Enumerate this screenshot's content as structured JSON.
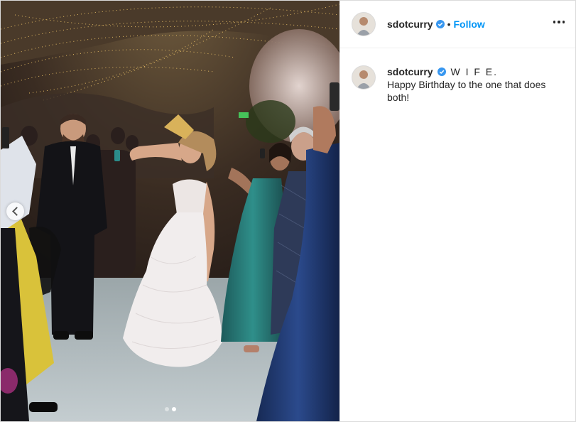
{
  "post": {
    "username": "sdotcurry",
    "verified": true,
    "bullet": "•",
    "follow_label": "Follow",
    "more_icon": "more-horizontal-icon"
  },
  "caption": {
    "username": "sdotcurry",
    "headline": "W I F E.",
    "body": "Happy Birthday to the one that does both!"
  },
  "carousel": {
    "total": 2,
    "current": 2,
    "prev_icon": "chevron-left-icon"
  },
  "colors": {
    "follow": "#0095f6",
    "verified": "#3897f0",
    "text": "#262626",
    "border": "#dbdbdb"
  }
}
